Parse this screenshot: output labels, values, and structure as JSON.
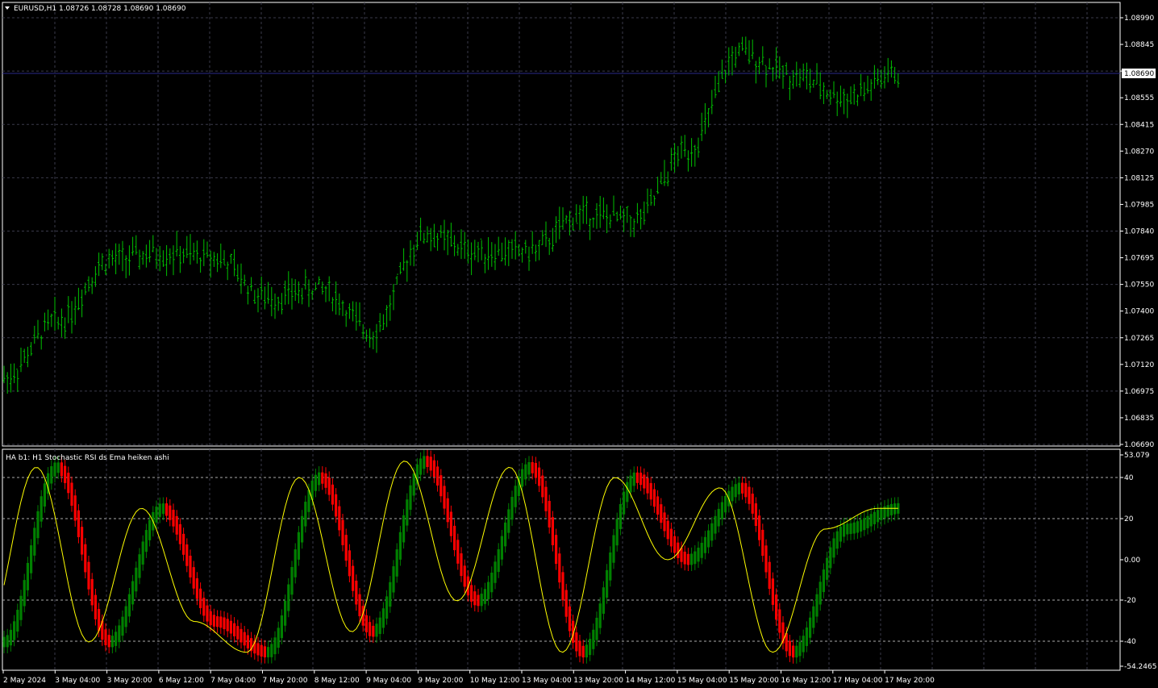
{
  "main_chart": {
    "title": "EURUSD,H1  1.08726 1.08728 1.08690 1.08690",
    "current_price": "1.08690",
    "price_ticks": [
      "1.08990",
      "1.08845",
      "1.08690",
      "1.08555",
      "1.08415",
      "1.08270",
      "1.08125",
      "1.07985",
      "1.07840",
      "1.07695",
      "1.07550",
      "1.07400",
      "1.07265",
      "1.07120",
      "1.06975",
      "1.06835",
      "1.06690"
    ],
    "bar_color": "#00c000"
  },
  "indicator": {
    "title": "HA b1: H1 Stochastic RSI ds Ema heiken ashi",
    "ticks": [
      "53.079",
      "40",
      "20",
      "0.00",
      "-20",
      "-40",
      "-54.2465"
    ],
    "colors": {
      "up": "#008000",
      "down": "#ff0000",
      "signal": "#ffff00"
    }
  },
  "time_axis": {
    "labels": [
      "2 May 2024",
      "3 May 04:00",
      "3 May 20:00",
      "6 May 12:00",
      "7 May 04:00",
      "7 May 20:00",
      "8 May 12:00",
      "9 May 04:00",
      "9 May 20:00",
      "10 May 12:00",
      "13 May 04:00",
      "13 May 20:00",
      "14 May 12:00",
      "15 May 04:00",
      "15 May 20:00",
      "16 May 12:00",
      "17 May 04:00",
      "17 May 20:00"
    ]
  },
  "chart_data": [
    {
      "type": "ohlc",
      "title": "EURUSD,H1",
      "ylim": [
        1.0669,
        1.0899
      ],
      "x": [
        "2 May 2024",
        "3 May 04:00",
        "3 May 20:00",
        "6 May 12:00",
        "7 May 04:00",
        "7 May 20:00",
        "8 May 12:00",
        "9 May 04:00",
        "9 May 20:00",
        "10 May 12:00",
        "13 May 04:00",
        "13 May 20:00",
        "14 May 12:00",
        "15 May 04:00",
        "15 May 20:00",
        "16 May 12:00",
        "17 May 04:00",
        "17 May 20:00"
      ],
      "close_approx": [
        1.0705,
        1.0735,
        1.0768,
        1.0772,
        1.077,
        1.0748,
        1.0753,
        1.073,
        1.0782,
        1.0773,
        1.0773,
        1.0793,
        1.079,
        1.0828,
        1.088,
        1.0868,
        1.0856,
        1.0869
      ]
    },
    {
      "type": "line",
      "title": "HA b1: H1 Stochastic RSI ds Ema heiken ashi",
      "ylim": [
        -54.2465,
        53.079
      ],
      "x": [
        "2 May 2024",
        "3 May 04:00",
        "3 May 20:00",
        "6 May 12:00",
        "7 May 04:00",
        "7 May 20:00",
        "8 May 12:00",
        "9 May 04:00",
        "9 May 20:00",
        "10 May 12:00",
        "13 May 04:00",
        "13 May 20:00",
        "14 May 12:00",
        "15 May 04:00",
        "15 May 20:00",
        "16 May 12:00",
        "17 May 04:00",
        "17 May 20:00"
      ],
      "values_approx": [
        -40,
        45,
        -40,
        25,
        -30,
        -45,
        40,
        -35,
        48,
        -20,
        45,
        -45,
        40,
        0,
        35,
        -45,
        15,
        25
      ]
    }
  ]
}
